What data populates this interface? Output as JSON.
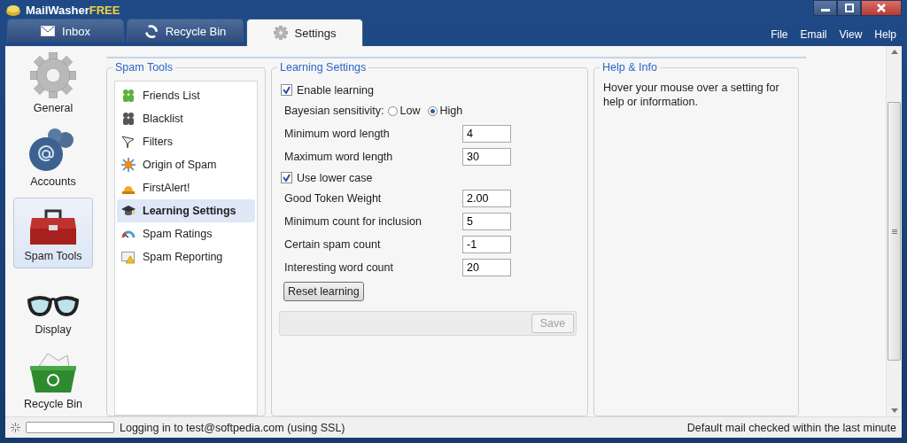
{
  "window": {
    "title_brand": "MailWasher",
    "title_edition": "FREE"
  },
  "tabs": [
    {
      "label": "Inbox",
      "selected": false
    },
    {
      "label": "Recycle Bin",
      "selected": false
    },
    {
      "label": "Settings",
      "selected": true
    }
  ],
  "menu": [
    "File",
    "Email",
    "View",
    "Help"
  ],
  "sidebar": {
    "items": [
      {
        "label": "General",
        "selected": false
      },
      {
        "label": "Accounts",
        "selected": false
      },
      {
        "label": "Spam Tools",
        "selected": true
      },
      {
        "label": "Display",
        "selected": false
      },
      {
        "label": "Recycle Bin",
        "selected": false
      }
    ]
  },
  "spam_tools": {
    "title": "Spam Tools",
    "items": [
      {
        "label": "Friends List",
        "selected": false
      },
      {
        "label": "Blacklist",
        "selected": false
      },
      {
        "label": "Filters",
        "selected": false
      },
      {
        "label": "Origin of Spam",
        "selected": false
      },
      {
        "label": "FirstAlert!",
        "selected": false
      },
      {
        "label": "Learning Settings",
        "selected": true
      },
      {
        "label": "Spam Ratings",
        "selected": false
      },
      {
        "label": "Spam Reporting",
        "selected": false
      }
    ]
  },
  "learning_settings": {
    "title": "Learning Settings",
    "rows": [
      {
        "kind": "checkbox",
        "label": "Enable learning",
        "checked": true
      },
      {
        "kind": "radio",
        "label": "Bayesian sensitivity:",
        "options": [
          {
            "label": "Low",
            "selected": false
          },
          {
            "label": "High",
            "selected": true
          }
        ]
      },
      {
        "kind": "field",
        "label": "Minimum word length",
        "value": "4"
      },
      {
        "kind": "field",
        "label": "Maximum word length",
        "value": "30"
      },
      {
        "kind": "checkbox",
        "label": "Use lower case",
        "checked": true
      },
      {
        "kind": "field",
        "label": "Good Token Weight",
        "value": "2.00"
      },
      {
        "kind": "field",
        "label": "Minimum count for inclusion",
        "value": "5"
      },
      {
        "kind": "field",
        "label": "Certain spam count",
        "value": "-1"
      },
      {
        "kind": "field",
        "label": "Interesting word count",
        "value": "20"
      },
      {
        "kind": "button",
        "label": "Reset learning"
      }
    ],
    "save_button": {
      "label": "Save",
      "disabled": true
    }
  },
  "help": {
    "title": "Help & Info",
    "text": "Hover your mouse over a setting for help or information."
  },
  "status_bar": {
    "progress": {
      "level": 0
    },
    "left": "Logging in to test@softpedia.com (using SSL)",
    "right": "Default mail checked within the last minute"
  }
}
